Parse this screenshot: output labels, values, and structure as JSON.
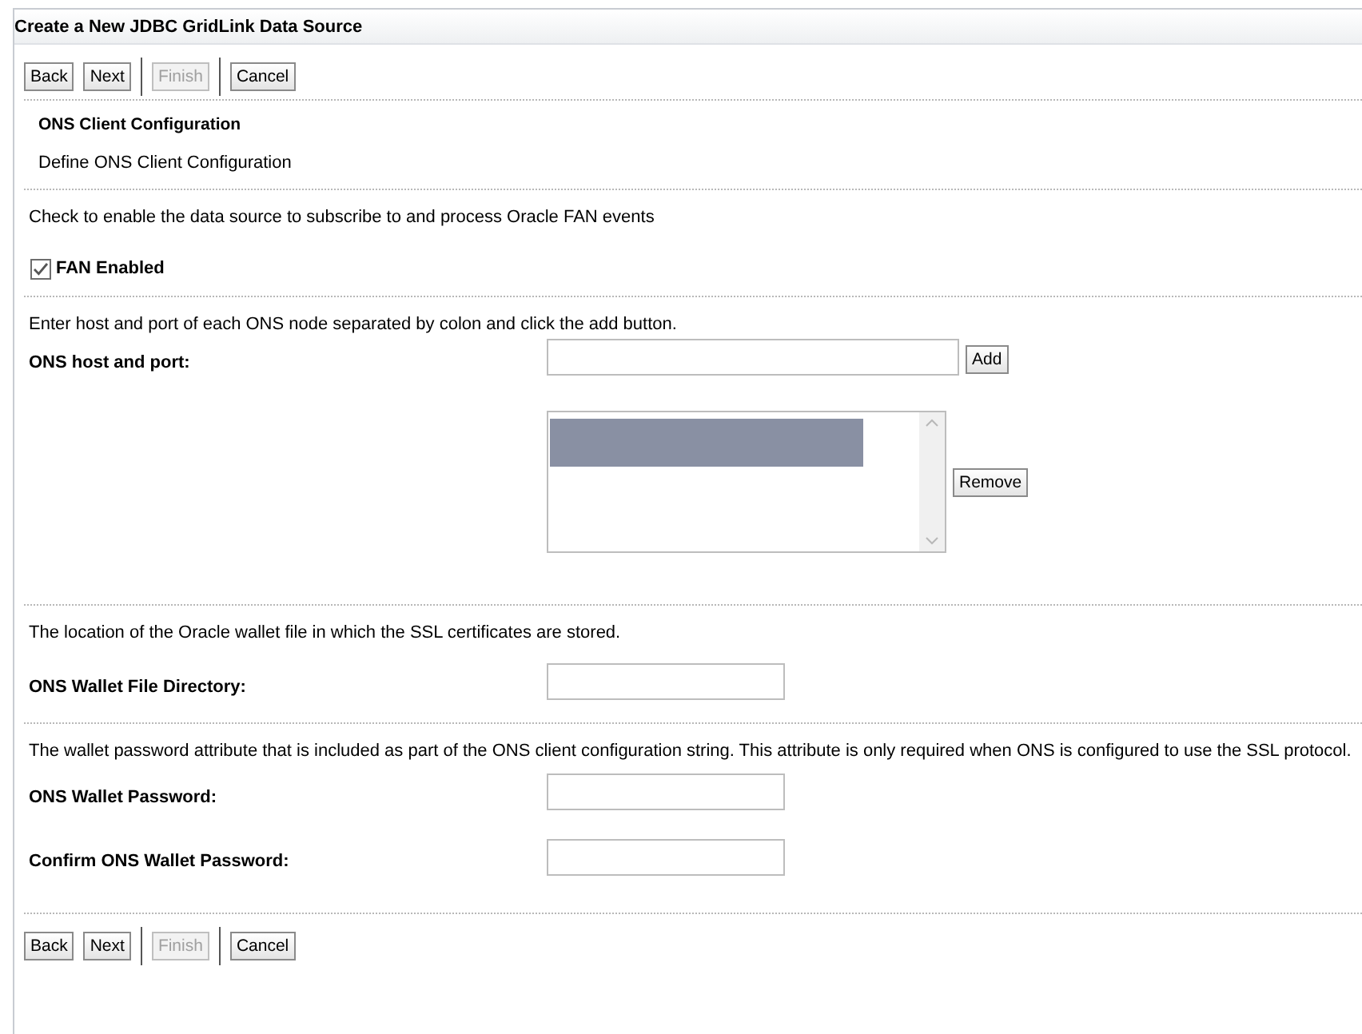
{
  "window": {
    "title": "Create a New JDBC GridLink Data Source"
  },
  "top_buttons": [
    {
      "label": "Back",
      "disabled": false,
      "separator_before": false
    },
    {
      "label": "Next",
      "disabled": false,
      "separator_before": false
    },
    {
      "label": "Finish",
      "disabled": true,
      "separator_before": true
    },
    {
      "label": "Cancel",
      "disabled": false,
      "separator_before": true
    }
  ],
  "section": {
    "title": "ONS Client Configuration",
    "subtitle": "Define ONS Client Configuration"
  },
  "fan": {
    "description": "Check to enable the data source to subscribe to and process Oracle FAN events",
    "label": "FAN Enabled",
    "checked": true
  },
  "ons_host": {
    "description": "Enter host and port of each ONS node separated by colon and click the add button.",
    "label": "ONS host and port:",
    "add_button": "Add",
    "remove_button": "Remove",
    "list_items": [
      {
        "selected": true
      }
    ]
  },
  "wallet_dir": {
    "description": "The location of the Oracle wallet file in which the SSL certificates are stored.",
    "label": "ONS Wallet File Directory:"
  },
  "wallet_password": {
    "description": "The wallet password attribute that is included as part of the ONS client configuration string. This attribute is only required when ONS is configured to use the SSL protocol.",
    "label": "ONS Wallet Password:"
  },
  "confirm_password": {
    "label": "Confirm ONS Wallet Password:"
  },
  "bottom_buttons": [
    {
      "label": "Back",
      "disabled": false,
      "separator_before": false
    },
    {
      "label": "Next",
      "disabled": false,
      "separator_before": false
    },
    {
      "label": "Finish",
      "disabled": true,
      "separator_before": true
    },
    {
      "label": "Cancel",
      "disabled": false,
      "separator_before": true
    }
  ]
}
